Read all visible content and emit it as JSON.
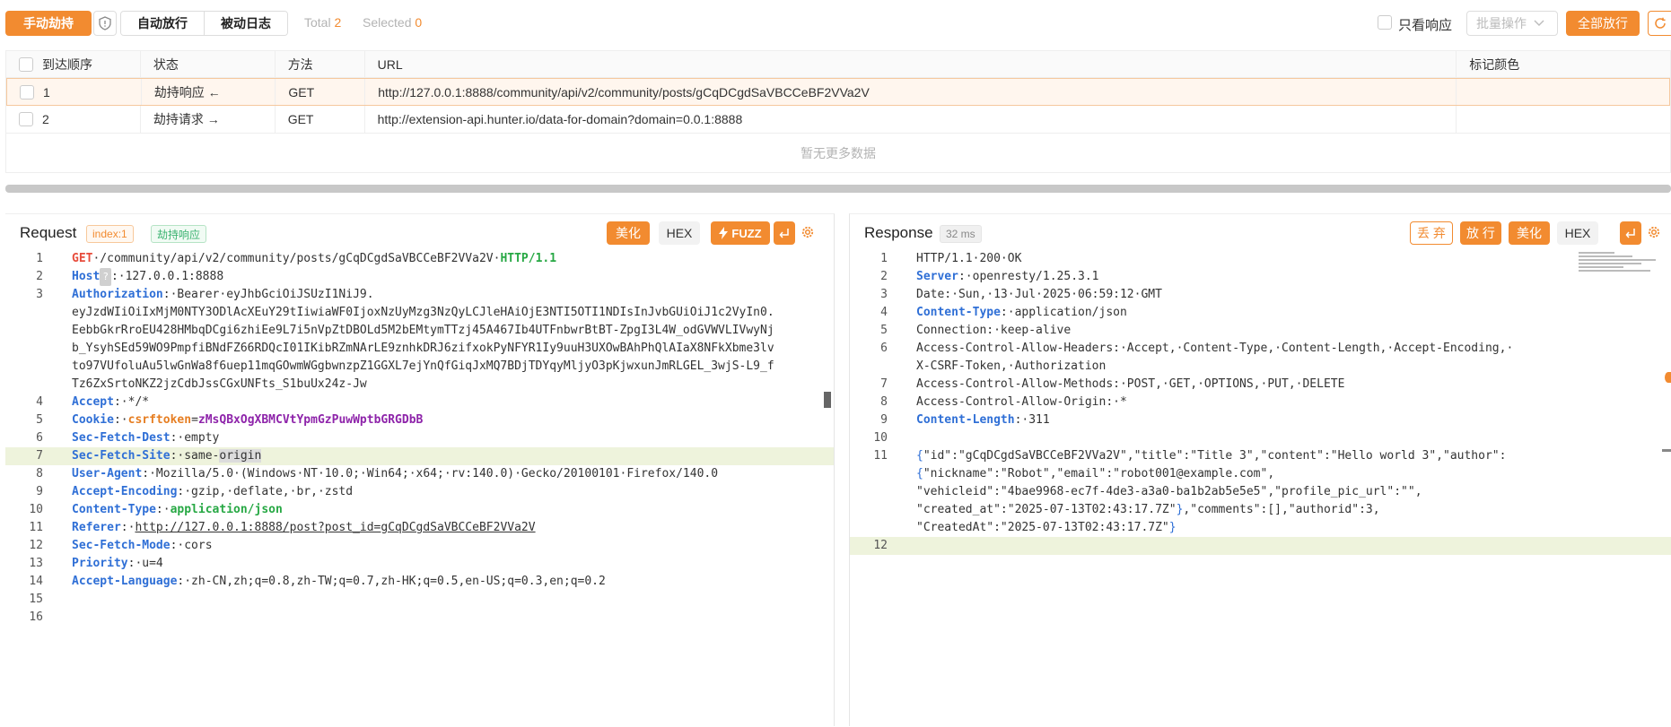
{
  "toolbar": {
    "manual_hijack": "手动劫持",
    "tabs": [
      "自动放行",
      "被动日志"
    ],
    "total_label": "Total",
    "total_value": "2",
    "selected_label": "Selected",
    "selected_value": "0",
    "only_response": "只看响应",
    "batch_ops": "批量操作",
    "release_all": "全部放行"
  },
  "table": {
    "headers": [
      "到达顺序",
      "状态",
      "方法",
      "URL",
      "标记颜色"
    ],
    "rows": [
      {
        "order": "1",
        "status": "劫持响应 ←",
        "method": "GET",
        "url": "http://127.0.0.1:8888/community/api/v2/community/posts/gCqDCgdSaVBCCeBF2VVa2V",
        "color": ""
      },
      {
        "order": "2",
        "status": "劫持请求 →",
        "method": "GET",
        "url": "http://extension-api.hunter.io/data-for-domain?domain=0.0.1:8888",
        "color": ""
      }
    ],
    "no_more": "暂无更多数据"
  },
  "request": {
    "title": "Request",
    "index_tag": "index:1",
    "status_tag": "劫持响应",
    "beautify": "美化",
    "hex": "HEX",
    "fuzz": "FUZZ",
    "lines": [
      {
        "n": "1",
        "parts": [
          [
            "red",
            "GET"
          ],
          [
            "",
            "·/community/api/v2/community/posts/gCqDCgdSaVBCCeBF2VVa2V·"
          ],
          [
            "green",
            "HTTP/1.1"
          ]
        ]
      },
      {
        "n": "2",
        "parts": [
          [
            "blue",
            "Host"
          ],
          [
            "q",
            "?"
          ],
          [
            "",
            ":·127.0.0.1:8888"
          ]
        ]
      },
      {
        "n": "3",
        "parts": [
          [
            "blue",
            "Authorization"
          ],
          [
            "",
            ":·Bearer·eyJhbGciOiJSUzI1NiJ9."
          ]
        ]
      },
      {
        "n": "",
        "parts": [
          [
            "",
            "eyJzdWIiOiIxMjM0NTY3ODlAcXEuY29tIiwiaWF0IjoxNzUyMzg3NzQyLCJleHAiOjE3NTI5OTI1NDIsInJvbGUiOiJ1c2VyIn0."
          ]
        ]
      },
      {
        "n": "",
        "parts": [
          [
            "",
            "EebbGkrRroEU428HMbqDCgi6zhiEe9L7i5nVpZtDBOLd5M2bEMtymTTzj45A467Ib4UTFnbwrBtBT-ZpgI3L4W_odGVWVLIVwyNj"
          ]
        ]
      },
      {
        "n": "",
        "parts": [
          [
            "",
            "b_YsyhSEd59WO9PmpfiBNdFZ66RDQcI01IKibRZmNArLE9znhkDRJ6zifxokPyNFYR1Iy9uuH3UXOwBAhPhQlAIaX8NFkXbme3lv"
          ]
        ]
      },
      {
        "n": "",
        "parts": [
          [
            "",
            "to97VUfoluAu5lwGnWa8f6uep11mqGOwmWGgbwnzpZ1GGXL7ejYnQfGiqJxMQ7BDjTDYqyMljyO3pKjwxunJmRLGEL_3wjS-L9_f"
          ]
        ]
      },
      {
        "n": "",
        "parts": [
          [
            "",
            "Tz6ZxSrtoNKZ2jzCdbJssCGxUNFts_S1buUx24z-Jw"
          ]
        ]
      },
      {
        "n": "4",
        "parts": [
          [
            "blue",
            "Accept"
          ],
          [
            "",
            ":·*/*"
          ]
        ]
      },
      {
        "n": "5",
        "parts": [
          [
            "blue",
            "Cookie"
          ],
          [
            "",
            ":·"
          ],
          [
            "orange",
            "csrftoken"
          ],
          [
            "",
            "="
          ],
          [
            "purple",
            "zMsQBxOgXBMCVtYpmGzPuwWptbGRGDbB"
          ]
        ]
      },
      {
        "n": "6",
        "parts": [
          [
            "blue",
            "Sec-Fetch-Dest"
          ],
          [
            "",
            ":·empty"
          ]
        ]
      },
      {
        "n": "7",
        "parts": [
          [
            "blue",
            "Sec-Fetch-Site"
          ],
          [
            "",
            ":·same-"
          ],
          [
            "hlword",
            "origin"
          ]
        ],
        "hl": true
      },
      {
        "n": "8",
        "parts": [
          [
            "blue",
            "User-Agent"
          ],
          [
            "",
            ":·Mozilla/5.0·(Windows·NT·10.0;·Win64;·x64;·rv:140.0)·Gecko/20100101·Firefox/140.0"
          ]
        ]
      },
      {
        "n": "9",
        "parts": [
          [
            "blue",
            "Accept-Encoding"
          ],
          [
            "",
            ":·gzip,·deflate,·br,·zstd"
          ]
        ]
      },
      {
        "n": "10",
        "parts": [
          [
            "blue",
            "Content-Type"
          ],
          [
            "",
            ":·"
          ],
          [
            "green",
            "application/json"
          ]
        ]
      },
      {
        "n": "11",
        "parts": [
          [
            "blue",
            "Referer"
          ],
          [
            "",
            ":·"
          ],
          [
            "ul",
            "http://127.0.0.1:8888/post?post_id=gCqDCgdSaVBCCeBF2VVa2V"
          ]
        ]
      },
      {
        "n": "12",
        "parts": [
          [
            "blue",
            "Sec-Fetch-Mode"
          ],
          [
            "",
            ":·cors"
          ]
        ]
      },
      {
        "n": "13",
        "parts": [
          [
            "blue",
            "Priority"
          ],
          [
            "",
            ":·u=4"
          ]
        ]
      },
      {
        "n": "14",
        "parts": [
          [
            "blue",
            "Accept-Language"
          ],
          [
            "",
            ":·zh-CN,zh;q=0.8,zh-TW;q=0.7,zh-HK;q=0.5,en-US;q=0.3,en;q=0.2"
          ]
        ]
      },
      {
        "n": "15",
        "parts": [
          [
            "",
            ""
          ]
        ]
      },
      {
        "n": "16",
        "parts": [
          [
            "",
            ""
          ]
        ]
      }
    ]
  },
  "response": {
    "title": "Response",
    "time_tag": "32 ms",
    "discard": "丢 弃",
    "release": "放 行",
    "beautify": "美化",
    "hex": "HEX",
    "lines": [
      {
        "n": "1",
        "parts": [
          [
            "",
            "HTTP/1.1·200·OK"
          ]
        ]
      },
      {
        "n": "2",
        "parts": [
          [
            "blue",
            "Server"
          ],
          [
            "",
            ":·openresty/1.25.3.1"
          ]
        ]
      },
      {
        "n": "3",
        "parts": [
          [
            "",
            "Date:·Sun,·13·Jul·2025·06:59:12·GMT"
          ]
        ]
      },
      {
        "n": "4",
        "parts": [
          [
            "blue",
            "Content-Type"
          ],
          [
            "",
            ":·application/json"
          ]
        ]
      },
      {
        "n": "5",
        "parts": [
          [
            "",
            "Connection:·keep-alive"
          ]
        ]
      },
      {
        "n": "6",
        "parts": [
          [
            "",
            "Access-Control-Allow-Headers:·Accept,·Content-Type,·Content-Length,·Accept-Encoding,·"
          ]
        ]
      },
      {
        "n": "",
        "parts": [
          [
            "",
            "X-CSRF-Token,·Authorization"
          ]
        ]
      },
      {
        "n": "7",
        "parts": [
          [
            "",
            "Access-Control-Allow-Methods:·POST,·GET,·OPTIONS,·PUT,·DELETE"
          ]
        ]
      },
      {
        "n": "8",
        "parts": [
          [
            "",
            "Access-Control-Allow-Origin:·*"
          ]
        ]
      },
      {
        "n": "9",
        "parts": [
          [
            "blue",
            "Content-Length"
          ],
          [
            "",
            ":·311"
          ]
        ]
      },
      {
        "n": "10",
        "parts": [
          [
            "",
            ""
          ]
        ]
      },
      {
        "n": "11",
        "parts": [
          [
            "bluebrace",
            "{"
          ],
          [
            "",
            "\"id\":\"gCqDCgdSaVBCCeBF2VVa2V\",\"title\":\"Title 3\",\"content\":\"Hello world 3\",\"author\":"
          ]
        ]
      },
      {
        "n": "",
        "parts": [
          [
            "bluebrace",
            "{"
          ],
          [
            "",
            "\"nickname\":\"Robot\",\"email\":\"robot001@example.com\","
          ]
        ]
      },
      {
        "n": "",
        "parts": [
          [
            "",
            "\"vehicleid\":\"4bae9968-ec7f-4de3-a3a0-ba1b2ab5e5e5\",\"profile_pic_url\":\"\","
          ]
        ]
      },
      {
        "n": "",
        "parts": [
          [
            "",
            "\"created_at\":\"2025-07-13T02:43:17.7Z\""
          ],
          [
            "bluebrace",
            "}"
          ],
          [
            "",
            ",\"comments\":[],\"authorid\":3,"
          ]
        ]
      },
      {
        "n": "",
        "parts": [
          [
            "",
            "\"CreatedAt\":\"2025-07-13T02:43:17.7Z\""
          ],
          [
            "bluebrace",
            "}"
          ]
        ]
      },
      {
        "n": "12",
        "parts": [
          [
            "",
            ""
          ]
        ],
        "hl": true
      }
    ]
  }
}
